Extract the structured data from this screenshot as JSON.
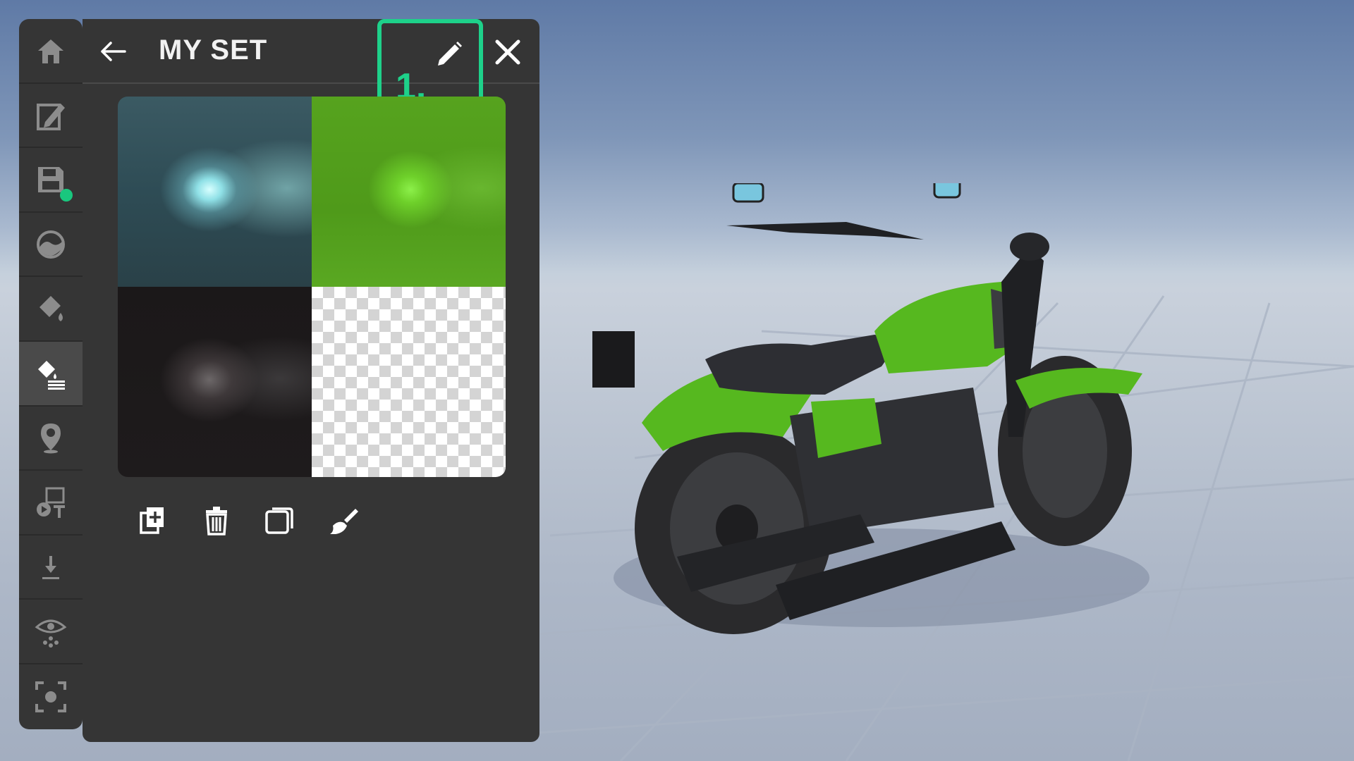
{
  "panel": {
    "title": "MY SET",
    "edit_step_label": "1."
  },
  "icons": {
    "back": "arrow-left-icon",
    "edit": "pencil-icon",
    "close": "close-icon"
  },
  "rail": {
    "items": [
      {
        "icon": "home-icon",
        "active": false
      },
      {
        "icon": "edit-document-icon",
        "active": false
      },
      {
        "icon": "save-icon",
        "active": false,
        "has_status_dot": true
      },
      {
        "icon": "environment-icon",
        "active": false
      },
      {
        "icon": "paint-bucket-icon",
        "active": false
      },
      {
        "icon": "material-set-icon",
        "active": true
      },
      {
        "icon": "location-pin-icon",
        "active": false
      },
      {
        "icon": "media-text-icon",
        "active": false
      },
      {
        "icon": "download-icon",
        "active": false
      },
      {
        "icon": "visibility-icon",
        "active": false
      },
      {
        "icon": "screenshot-focus-icon",
        "active": false
      }
    ]
  },
  "texture_tiles": [
    {
      "name": "teal-texture"
    },
    {
      "name": "green-texture"
    },
    {
      "name": "dark-texture"
    },
    {
      "name": "transparent-texture"
    }
  ],
  "toolbar": {
    "items": [
      {
        "icon": "add-copy-icon"
      },
      {
        "icon": "trash-icon"
      },
      {
        "icon": "duplicate-icon"
      },
      {
        "icon": "brush-icon"
      }
    ]
  },
  "colors": {
    "accent": "#1ed18a",
    "status_dot": "#19c77e",
    "panel_bg": "#353535",
    "bike_green": "#56b81f"
  }
}
